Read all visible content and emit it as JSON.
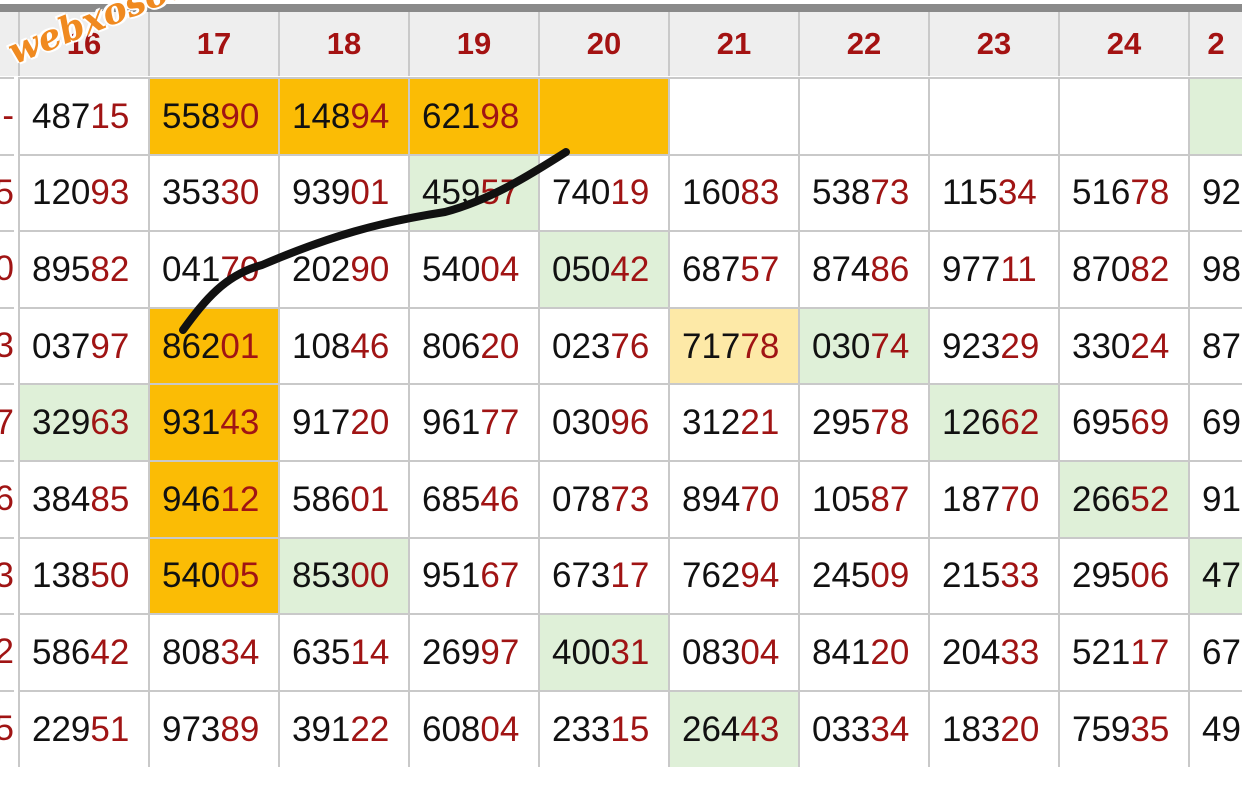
{
  "watermark": "webxoso.net",
  "columns": [
    "16",
    "17",
    "18",
    "19",
    "20",
    "21",
    "22",
    "23",
    "24",
    "2"
  ],
  "left_edge": [
    "-",
    "5",
    "0",
    "3",
    "7",
    "6",
    "3",
    "2",
    "5"
  ],
  "rows": [
    [
      {
        "a": "487",
        "b": "15",
        "bg": ""
      },
      {
        "a": "558",
        "b": "90",
        "bg": "orange"
      },
      {
        "a": "148",
        "b": "94",
        "bg": "orange"
      },
      {
        "a": "621",
        "b": "98",
        "bg": "orange"
      },
      {
        "a": "",
        "b": "",
        "bg": "orange"
      },
      {
        "a": "",
        "b": "",
        "bg": ""
      },
      {
        "a": "",
        "b": "",
        "bg": ""
      },
      {
        "a": "",
        "b": "",
        "bg": ""
      },
      {
        "a": "",
        "b": "",
        "bg": ""
      },
      {
        "a": "",
        "b": "",
        "bg": "green"
      }
    ],
    [
      {
        "a": "120",
        "b": "93",
        "bg": ""
      },
      {
        "a": "353",
        "b": "30",
        "bg": ""
      },
      {
        "a": "939",
        "b": "01",
        "bg": ""
      },
      {
        "a": "459",
        "b": "57",
        "bg": "green"
      },
      {
        "a": "740",
        "b": "19",
        "bg": ""
      },
      {
        "a": "160",
        "b": "83",
        "bg": ""
      },
      {
        "a": "538",
        "b": "73",
        "bg": ""
      },
      {
        "a": "115",
        "b": "34",
        "bg": ""
      },
      {
        "a": "516",
        "b": "78",
        "bg": ""
      },
      {
        "a": "92",
        "b": "",
        "bg": ""
      }
    ],
    [
      {
        "a": "895",
        "b": "82",
        "bg": ""
      },
      {
        "a": "041",
        "b": "70",
        "bg": ""
      },
      {
        "a": "202",
        "b": "90",
        "bg": ""
      },
      {
        "a": "540",
        "b": "04",
        "bg": ""
      },
      {
        "a": "050",
        "b": "42",
        "bg": "green"
      },
      {
        "a": "687",
        "b": "57",
        "bg": ""
      },
      {
        "a": "874",
        "b": "86",
        "bg": ""
      },
      {
        "a": "977",
        "b": "11",
        "bg": ""
      },
      {
        "a": "870",
        "b": "82",
        "bg": ""
      },
      {
        "a": "98",
        "b": "",
        "bg": ""
      }
    ],
    [
      {
        "a": "037",
        "b": "97",
        "bg": ""
      },
      {
        "a": "862",
        "b": "01",
        "bg": "orange"
      },
      {
        "a": "108",
        "b": "46",
        "bg": ""
      },
      {
        "a": "806",
        "b": "20",
        "bg": ""
      },
      {
        "a": "023",
        "b": "76",
        "bg": ""
      },
      {
        "a": "717",
        "b": "78",
        "bg": "yellow"
      },
      {
        "a": "030",
        "b": "74",
        "bg": "green"
      },
      {
        "a": "923",
        "b": "29",
        "bg": ""
      },
      {
        "a": "330",
        "b": "24",
        "bg": ""
      },
      {
        "a": "87",
        "b": "",
        "bg": ""
      }
    ],
    [
      {
        "a": "329",
        "b": "63",
        "bg": "green"
      },
      {
        "a": "931",
        "b": "43",
        "bg": "orange"
      },
      {
        "a": "917",
        "b": "20",
        "bg": ""
      },
      {
        "a": "961",
        "b": "77",
        "bg": ""
      },
      {
        "a": "030",
        "b": "96",
        "bg": ""
      },
      {
        "a": "312",
        "b": "21",
        "bg": ""
      },
      {
        "a": "295",
        "b": "78",
        "bg": ""
      },
      {
        "a": "126",
        "b": "62",
        "bg": "green"
      },
      {
        "a": "695",
        "b": "69",
        "bg": ""
      },
      {
        "a": "69",
        "b": "",
        "bg": ""
      }
    ],
    [
      {
        "a": "384",
        "b": "85",
        "bg": ""
      },
      {
        "a": "946",
        "b": "12",
        "bg": "orange"
      },
      {
        "a": "586",
        "b": "01",
        "bg": ""
      },
      {
        "a": "685",
        "b": "46",
        "bg": ""
      },
      {
        "a": "078",
        "b": "73",
        "bg": ""
      },
      {
        "a": "894",
        "b": "70",
        "bg": ""
      },
      {
        "a": "105",
        "b": "87",
        "bg": ""
      },
      {
        "a": "187",
        "b": "70",
        "bg": ""
      },
      {
        "a": "266",
        "b": "52",
        "bg": "green"
      },
      {
        "a": "91",
        "b": "",
        "bg": ""
      }
    ],
    [
      {
        "a": "138",
        "b": "50",
        "bg": ""
      },
      {
        "a": "540",
        "b": "05",
        "bg": "orange"
      },
      {
        "a": "853",
        "b": "00",
        "bg": "green"
      },
      {
        "a": "951",
        "b": "67",
        "bg": ""
      },
      {
        "a": "673",
        "b": "17",
        "bg": ""
      },
      {
        "a": "762",
        "b": "94",
        "bg": ""
      },
      {
        "a": "245",
        "b": "09",
        "bg": ""
      },
      {
        "a": "215",
        "b": "33",
        "bg": ""
      },
      {
        "a": "295",
        "b": "06",
        "bg": ""
      },
      {
        "a": "47",
        "b": "",
        "bg": "green"
      }
    ],
    [
      {
        "a": "586",
        "b": "42",
        "bg": ""
      },
      {
        "a": "808",
        "b": "34",
        "bg": ""
      },
      {
        "a": "635",
        "b": "14",
        "bg": ""
      },
      {
        "a": "269",
        "b": "97",
        "bg": ""
      },
      {
        "a": "400",
        "b": "31",
        "bg": "green"
      },
      {
        "a": "083",
        "b": "04",
        "bg": ""
      },
      {
        "a": "841",
        "b": "20",
        "bg": ""
      },
      {
        "a": "204",
        "b": "33",
        "bg": ""
      },
      {
        "a": "521",
        "b": "17",
        "bg": ""
      },
      {
        "a": "67",
        "b": "",
        "bg": ""
      }
    ],
    [
      {
        "a": "229",
        "b": "51",
        "bg": ""
      },
      {
        "a": "973",
        "b": "89",
        "bg": ""
      },
      {
        "a": "391",
        "b": "22",
        "bg": ""
      },
      {
        "a": "608",
        "b": "04",
        "bg": ""
      },
      {
        "a": "233",
        "b": "15",
        "bg": ""
      },
      {
        "a": "264",
        "b": "43",
        "bg": "green"
      },
      {
        "a": "033",
        "b": "34",
        "bg": ""
      },
      {
        "a": "183",
        "b": "20",
        "bg": ""
      },
      {
        "a": "759",
        "b": "35",
        "bg": ""
      },
      {
        "a": "49",
        "b": "",
        "bg": ""
      }
    ]
  ],
  "colors": {
    "header_text": "#a41212",
    "tail_digits": "#a01414",
    "highlight_orange": "#fbbc05",
    "highlight_green": "#dff0d8",
    "highlight_yellow": "#fde9a7",
    "grid_line": "#c9c9c9",
    "pen_stroke": "#111111"
  }
}
